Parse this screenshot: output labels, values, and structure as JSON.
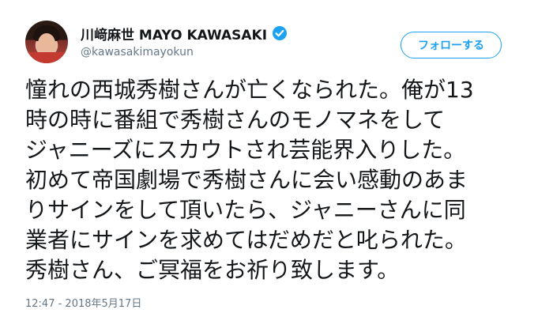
{
  "user": {
    "display_name": "川﨑麻世 MAYO KAWASAKI",
    "handle": "@kawasakimayokun",
    "verified_icon": "verified-badge-icon",
    "avatar_icon": "profile-photo"
  },
  "follow_button": {
    "label": "フォローする"
  },
  "tweet": {
    "lines": [
      "憧れの西城秀樹さんが亡くなられた。俺が13",
      "時の時に番組で秀樹さんのモノマネをして",
      "ジャニーズにスカウトされ芸能界入りした。",
      "初めて帝国劇場で秀樹さんに会い感動のあま",
      "りサインをして頂いたら、ジャニーさんに同",
      "業者にサインを求めてはだめだと叱られた。",
      "秀樹さん、ご冥福をお祈り致します。"
    ],
    "timestamp": "12:47 - 2018年5月17日"
  },
  "colors": {
    "accent": "#1da1f2",
    "text": "#14171a",
    "secondary": "#657786"
  }
}
